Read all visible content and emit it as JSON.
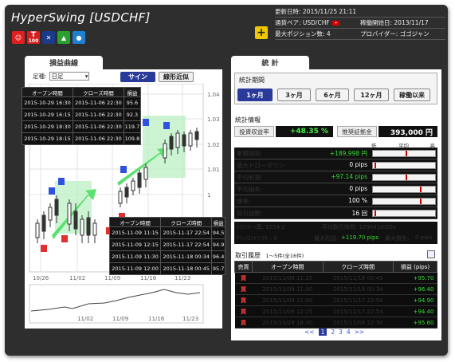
{
  "header": {
    "title": "HyperSwing [USDCHF]",
    "updated_label": "更新日時: 2015/11/25 21:11",
    "pair_label": "通貨ペア: USD/CHF",
    "start_label": "稼働開始日: 2013/11/17",
    "maxpos_label": "最大ポジション数: 4",
    "provider_label": "プロバイダー: ゴゴジャン",
    "plus": "+",
    "icon_100": "100"
  },
  "left": {
    "tab": "損益曲線",
    "period_label": "足種:",
    "period_value": "日足",
    "sign_button": "サイン",
    "line_button": "線形近似",
    "y_ticks": [
      "1.04",
      "1.03",
      "1.02",
      "1.01",
      "1"
    ],
    "x_ticks": [
      "10/26",
      "11/02",
      "11/09",
      "11/16",
      "11/23"
    ],
    "mini_x_ticks": [
      "11/02",
      "11/09",
      "11/16",
      "11/23"
    ],
    "popup1": {
      "headers": [
        "オープン時間",
        "クローズ時間",
        "損益"
      ],
      "rows": [
        [
          "2015-10-29 16:30",
          "2015-11-06 22:30",
          "95.6"
        ],
        [
          "2015-10-29 16:15",
          "2015-11-06 22:30",
          "92.3"
        ],
        [
          "2015-10-29 18:30",
          "2015-11-06 22:30",
          "119.7"
        ],
        [
          "2015-10-29 18:15",
          "2015-11-06 22:30",
          "109.8"
        ]
      ]
    },
    "popup2": {
      "headers": [
        "オープン時間",
        "クローズ時間",
        "損益"
      ],
      "rows": [
        [
          "2015-11-09 11:15",
          "2015-11-17 22:54",
          "94.5"
        ],
        [
          "2015-11-09 12:15",
          "2015-11-17 22:54",
          "94.9"
        ],
        [
          "2015-11-09 11:30",
          "2015-11-18 00:34",
          "96.4"
        ],
        [
          "2015-11-09 12:00",
          "2015-11-18 00:45",
          "95.7"
        ]
      ]
    }
  },
  "right": {
    "tab": "統 計",
    "period_title": "統計期間",
    "periods": [
      "1ヶ月",
      "3ヶ月",
      "6ヶ月",
      "12ヶ月",
      "稼働以来"
    ],
    "stats_title": "統計情報",
    "invest_label": "投資収益率",
    "invest_value": "+48.35 %",
    "margin_label": "推奨証拠金",
    "margin_value": "393,000 円",
    "scale": [
      "低",
      "平均",
      "高"
    ],
    "stats": [
      {
        "label": "累積損益:",
        "value": "+189,998 円",
        "color": "#33dd33",
        "pos": 52
      },
      {
        "label": "最大ドローダウン:",
        "value": "0 pips",
        "color": "#ffffff",
        "pos": 3
      },
      {
        "label": "平均利益:",
        "value": "+97.14 pips",
        "color": "#33dd33",
        "pos": 52
      },
      {
        "label": "平均損失:",
        "value": "0 pips",
        "color": "#ffffff",
        "pos": 76
      },
      {
        "label": "勝率:",
        "value": "100 %",
        "color": "#ffffff",
        "pos": 76
      },
      {
        "label": "取引回数:",
        "value": "16 回",
        "color": "#ffffff",
        "pos": 3
      }
    ],
    "risk_return_label": "ﾘｽｸﾘﾀｰﾝ率: 1554.2",
    "avg_hold_label": "平均取引時間: 129h41m20s",
    "affiliate_label": "ｱﾌｨﾘｴｲﾄﾌｧｸﾀｰ: 0",
    "max_profit_label": "最大利益:",
    "max_profit_value": "+119.70 pips",
    "max_loss_label": "最大損失:",
    "max_loss_value": "0 pips",
    "history_title": "取引履歴",
    "history_sub": "1～5件(全16件)",
    "history_headers": [
      "売買",
      "オープン時間",
      "クローズ時間",
      "損益 (pips)"
    ],
    "history_rows": [
      [
        "買",
        "2015/11/09 11:15",
        "2015/11/18 00:45",
        "+95.70"
      ],
      [
        "買",
        "2015/11/09 11:30",
        "2015/11/18 00:34",
        "+96.40"
      ],
      [
        "買",
        "2015/11/09 12:00",
        "2015/11/17 22:54",
        "+94.90"
      ],
      [
        "買",
        "2015/11/09 12:15",
        "2015/11/17 22:54",
        "+94.40"
      ],
      [
        "買",
        "2015/10/29 16:30",
        "2015/11/06 22:30",
        "+95.60"
      ]
    ],
    "pager": [
      "<<",
      "1",
      "2",
      "3",
      "4",
      ">>"
    ]
  }
}
